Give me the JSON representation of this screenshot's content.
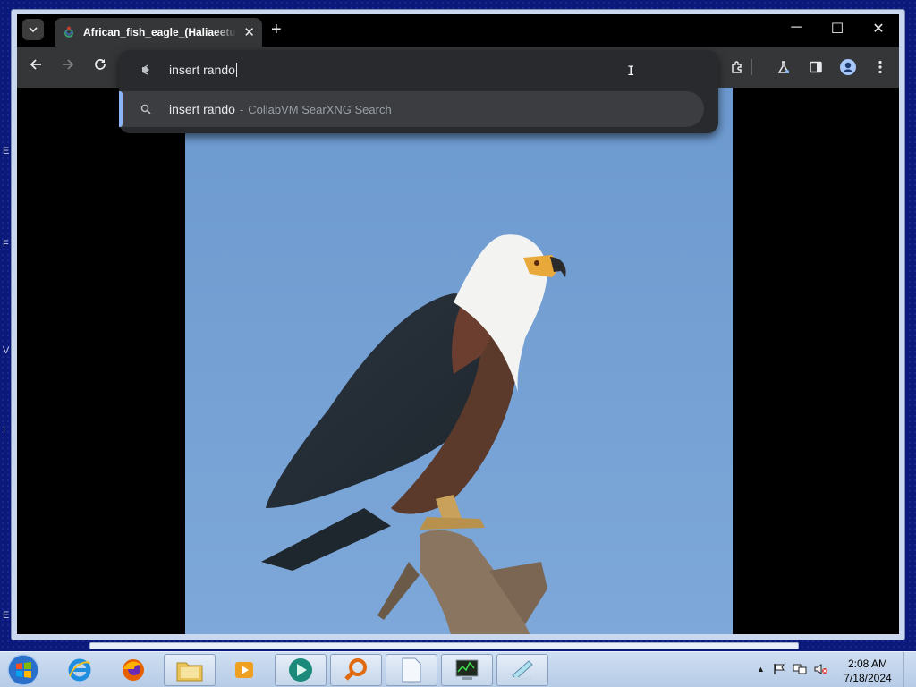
{
  "desktop": {
    "side_letters": [
      "E",
      "F",
      "V",
      "I",
      "E"
    ]
  },
  "browser": {
    "tab": {
      "title": "African_fish_eagle_(Haliaeetus_vocifer).jpg",
      "favicon": "wikimedia-icon"
    },
    "omnibox": {
      "value": "insert rando",
      "suggestion": {
        "query": "insert rando",
        "separator": "-",
        "engine": "CollabVM SearXNG Search"
      }
    },
    "content": {
      "image_subject": "eagle-photo"
    },
    "accent": "#8ab4f8"
  },
  "taskbar": {
    "clock_time": "2:08 AM",
    "clock_date": "7/18/2024"
  }
}
